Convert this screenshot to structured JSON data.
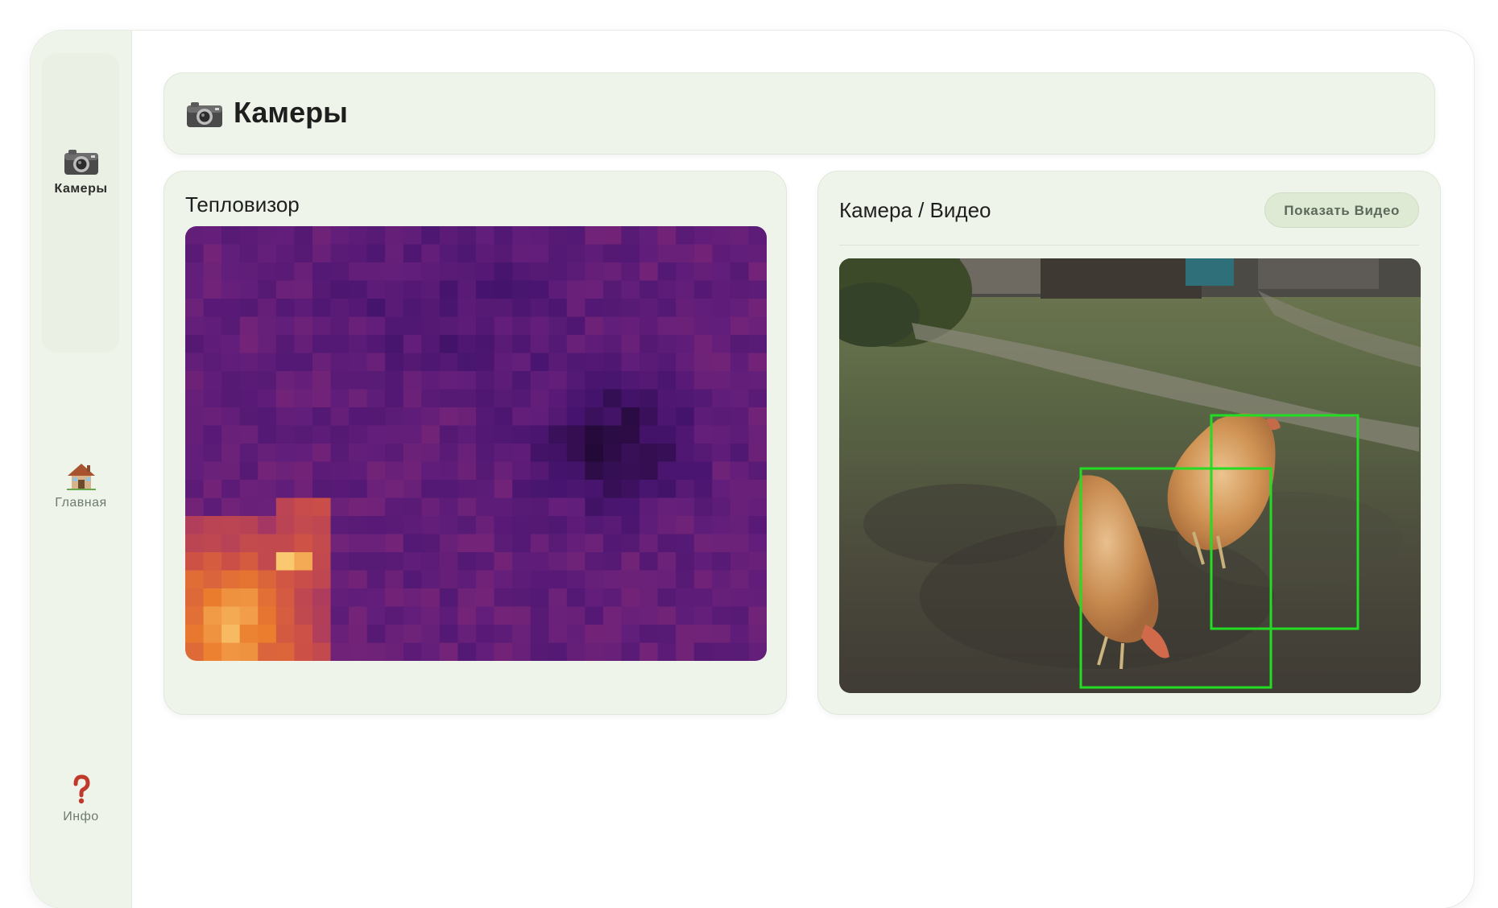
{
  "sidebar": {
    "items": [
      {
        "label": "Камеры",
        "icon": "camera-icon",
        "active": true
      },
      {
        "label": "Главная",
        "icon": "house-icon",
        "active": false
      },
      {
        "label": "Инфо",
        "icon": "question-mark-icon",
        "active": false
      }
    ]
  },
  "header": {
    "icon": "camera-icon",
    "title": "Камеры"
  },
  "thermal_panel": {
    "title": "Тепловизор"
  },
  "video_panel": {
    "title": "Камера / Видео",
    "show_video_label": "Показать Видео",
    "detections": [
      {
        "object": "hen",
        "label_color": "#22dd22"
      },
      {
        "object": "hen",
        "label_color": "#22dd22"
      }
    ]
  },
  "colors": {
    "accent": "#eef4ea",
    "button_bg": "#dfead5",
    "detection_box": "#22dd22"
  }
}
